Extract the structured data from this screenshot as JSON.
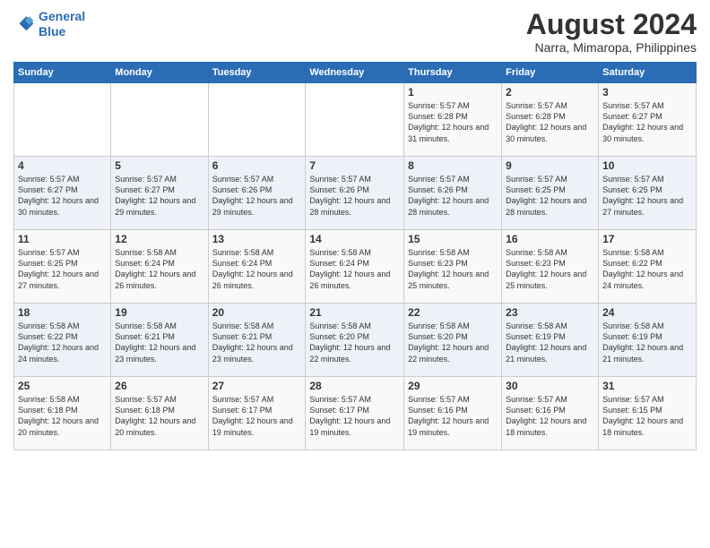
{
  "header": {
    "logo_line1": "General",
    "logo_line2": "Blue",
    "main_title": "August 2024",
    "subtitle": "Narra, Mimaropa, Philippines"
  },
  "calendar": {
    "days_of_week": [
      "Sunday",
      "Monday",
      "Tuesday",
      "Wednesday",
      "Thursday",
      "Friday",
      "Saturday"
    ],
    "weeks": [
      [
        {
          "day": "",
          "content": ""
        },
        {
          "day": "",
          "content": ""
        },
        {
          "day": "",
          "content": ""
        },
        {
          "day": "",
          "content": ""
        },
        {
          "day": "1",
          "content": "Sunrise: 5:57 AM\nSunset: 6:28 PM\nDaylight: 12 hours\nand 31 minutes."
        },
        {
          "day": "2",
          "content": "Sunrise: 5:57 AM\nSunset: 6:28 PM\nDaylight: 12 hours\nand 30 minutes."
        },
        {
          "day": "3",
          "content": "Sunrise: 5:57 AM\nSunset: 6:27 PM\nDaylight: 12 hours\nand 30 minutes."
        }
      ],
      [
        {
          "day": "4",
          "content": "Sunrise: 5:57 AM\nSunset: 6:27 PM\nDaylight: 12 hours\nand 30 minutes."
        },
        {
          "day": "5",
          "content": "Sunrise: 5:57 AM\nSunset: 6:27 PM\nDaylight: 12 hours\nand 29 minutes."
        },
        {
          "day": "6",
          "content": "Sunrise: 5:57 AM\nSunset: 6:26 PM\nDaylight: 12 hours\nand 29 minutes."
        },
        {
          "day": "7",
          "content": "Sunrise: 5:57 AM\nSunset: 6:26 PM\nDaylight: 12 hours\nand 28 minutes."
        },
        {
          "day": "8",
          "content": "Sunrise: 5:57 AM\nSunset: 6:26 PM\nDaylight: 12 hours\nand 28 minutes."
        },
        {
          "day": "9",
          "content": "Sunrise: 5:57 AM\nSunset: 6:25 PM\nDaylight: 12 hours\nand 28 minutes."
        },
        {
          "day": "10",
          "content": "Sunrise: 5:57 AM\nSunset: 6:25 PM\nDaylight: 12 hours\nand 27 minutes."
        }
      ],
      [
        {
          "day": "11",
          "content": "Sunrise: 5:57 AM\nSunset: 6:25 PM\nDaylight: 12 hours\nand 27 minutes."
        },
        {
          "day": "12",
          "content": "Sunrise: 5:58 AM\nSunset: 6:24 PM\nDaylight: 12 hours\nand 26 minutes."
        },
        {
          "day": "13",
          "content": "Sunrise: 5:58 AM\nSunset: 6:24 PM\nDaylight: 12 hours\nand 26 minutes."
        },
        {
          "day": "14",
          "content": "Sunrise: 5:58 AM\nSunset: 6:24 PM\nDaylight: 12 hours\nand 26 minutes."
        },
        {
          "day": "15",
          "content": "Sunrise: 5:58 AM\nSunset: 6:23 PM\nDaylight: 12 hours\nand 25 minutes."
        },
        {
          "day": "16",
          "content": "Sunrise: 5:58 AM\nSunset: 6:23 PM\nDaylight: 12 hours\nand 25 minutes."
        },
        {
          "day": "17",
          "content": "Sunrise: 5:58 AM\nSunset: 6:22 PM\nDaylight: 12 hours\nand 24 minutes."
        }
      ],
      [
        {
          "day": "18",
          "content": "Sunrise: 5:58 AM\nSunset: 6:22 PM\nDaylight: 12 hours\nand 24 minutes."
        },
        {
          "day": "19",
          "content": "Sunrise: 5:58 AM\nSunset: 6:21 PM\nDaylight: 12 hours\nand 23 minutes."
        },
        {
          "day": "20",
          "content": "Sunrise: 5:58 AM\nSunset: 6:21 PM\nDaylight: 12 hours\nand 23 minutes."
        },
        {
          "day": "21",
          "content": "Sunrise: 5:58 AM\nSunset: 6:20 PM\nDaylight: 12 hours\nand 22 minutes."
        },
        {
          "day": "22",
          "content": "Sunrise: 5:58 AM\nSunset: 6:20 PM\nDaylight: 12 hours\nand 22 minutes."
        },
        {
          "day": "23",
          "content": "Sunrise: 5:58 AM\nSunset: 6:19 PM\nDaylight: 12 hours\nand 21 minutes."
        },
        {
          "day": "24",
          "content": "Sunrise: 5:58 AM\nSunset: 6:19 PM\nDaylight: 12 hours\nand 21 minutes."
        }
      ],
      [
        {
          "day": "25",
          "content": "Sunrise: 5:58 AM\nSunset: 6:18 PM\nDaylight: 12 hours\nand 20 minutes."
        },
        {
          "day": "26",
          "content": "Sunrise: 5:57 AM\nSunset: 6:18 PM\nDaylight: 12 hours\nand 20 minutes."
        },
        {
          "day": "27",
          "content": "Sunrise: 5:57 AM\nSunset: 6:17 PM\nDaylight: 12 hours\nand 19 minutes."
        },
        {
          "day": "28",
          "content": "Sunrise: 5:57 AM\nSunset: 6:17 PM\nDaylight: 12 hours\nand 19 minutes."
        },
        {
          "day": "29",
          "content": "Sunrise: 5:57 AM\nSunset: 6:16 PM\nDaylight: 12 hours\nand 19 minutes."
        },
        {
          "day": "30",
          "content": "Sunrise: 5:57 AM\nSunset: 6:16 PM\nDaylight: 12 hours\nand 18 minutes."
        },
        {
          "day": "31",
          "content": "Sunrise: 5:57 AM\nSunset: 6:15 PM\nDaylight: 12 hours\nand 18 minutes."
        }
      ]
    ]
  }
}
